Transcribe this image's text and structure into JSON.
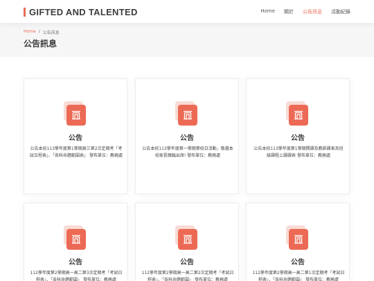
{
  "header": {
    "logo": "GIFTED AND TALENTED",
    "nav": [
      "Home",
      "關於",
      "公告訊息",
      "活動紀錄"
    ],
    "active_nav": 2
  },
  "breadcrumb": {
    "home": "Home",
    "separator": "/",
    "current": "公告訊息"
  },
  "page_title": "公告訊息",
  "icon": "building-icon",
  "accent_color": "#e96b56",
  "cards": [
    {
      "title": "公告",
      "desc": "公告本校113學年度第1學期高三第2次定期考「考試日程表」、「各科命題範圍表」 發布單位：教務處"
    },
    {
      "title": "公告",
      "desc": "公告本校113學年度第一學期學校日活動，敬邀本校家長親臨出席! 發布單位：教務處"
    },
    {
      "title": "公告",
      "desc": "公告本校113學年度第1學期開課及教師課表及班級課程上課課表 發布單位：教務處"
    },
    {
      "title": "公告",
      "desc": "112學年度第2學期高一高二第3次定期考「考試日程表」、「各科命題範圍」 發布單位：教務處"
    },
    {
      "title": "公告",
      "desc": "112學年度第2學期高一高二第2次定期考「考試日程表」、「各科命題範圍」 發布單位：教務處"
    },
    {
      "title": "公告",
      "desc": "112學年度第2學期高一高二第1次定期考「考試日程表」、「各科命題範圍」 發布單位：教務處"
    }
  ]
}
